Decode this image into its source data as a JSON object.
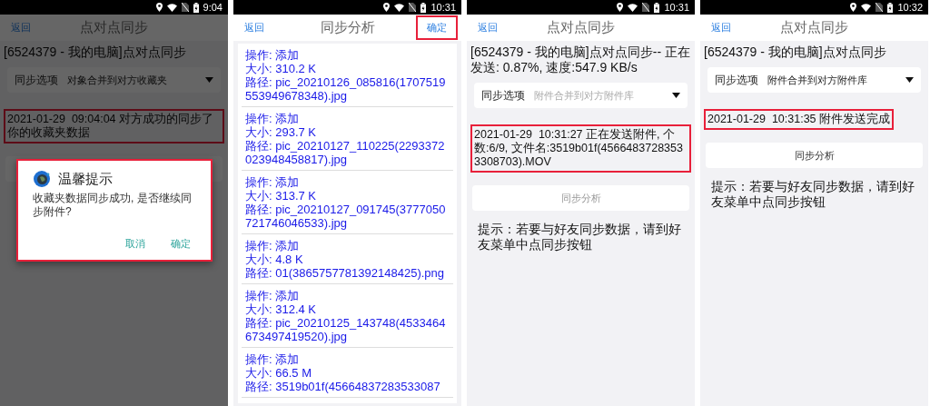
{
  "screens": [
    {
      "kind": "sync",
      "time": "9:04",
      "back": "返回",
      "title": "点对点同步",
      "device_line": "[6524379 - 我的电脑]点对点同步",
      "option": {
        "label": "同步选项",
        "value": "对象合并到对方收藏夹",
        "disabled": false
      },
      "message": {
        "text": "2021-01-29  09:04:04 对方成功的同步了你的收藏夹数据",
        "highlighted": true
      },
      "dimmed": true,
      "dialog": {
        "title": "温馨提示",
        "message": "收藏夹数据同步成功, 是否继续同步附件?",
        "buttons": [
          "取消",
          "确定"
        ],
        "highlighted": true
      }
    },
    {
      "kind": "analysis",
      "time": "10:31",
      "back": "返回",
      "title": "同步分析",
      "action": {
        "label": "确定",
        "highlighted": true
      },
      "items": [
        {
          "operation": "操作: 添加",
          "size": "大小: 310.2 K",
          "path": "路径: pic_20210126_085816(1707519553949678348).jpg"
        },
        {
          "operation": "操作: 添加",
          "size": "大小: 293.7 K",
          "path": "路径: pic_20210127_110225(2293372023948458817).jpg"
        },
        {
          "operation": "操作: 添加",
          "size": "大小: 313.7 K",
          "path": "路径: pic_20210127_091745(3777050721746046533).jpg"
        },
        {
          "operation": "操作: 添加",
          "size": "大小: 4.8 K",
          "path": "路径: 01(3865757781392148425).png"
        },
        {
          "operation": "操作: 添加",
          "size": "大小: 312.4 K",
          "path": "路径: pic_20210125_143748(4533464673497419520).jpg"
        },
        {
          "operation": "操作: 添加",
          "size": "大小: 66.5 M",
          "path": "路径: 3519b01f(45664837283533087"
        }
      ]
    },
    {
      "kind": "sync",
      "time": "10:31",
      "back": "返回",
      "title": "点对点同步",
      "device_line": "[6524379 - 我的电脑]点对点同步-- 正在发送: 0.87%, 速度:547.9 KB/s",
      "option": {
        "label": "同步选项",
        "value": "附件合并到对方附件库",
        "disabled": true
      },
      "message": {
        "text": "2021-01-29  10:31:27 正在发送附件, 个数:6/9, 文件名:3519b01f(45664837283533308703).MOV",
        "highlighted": true
      },
      "analysis_button": {
        "label": "同步分析",
        "disabled": true
      },
      "hint": "提示：若要与好友同步数据，请到好友菜单中点同步按钮",
      "dimmed": false
    },
    {
      "kind": "sync",
      "time": "10:32",
      "back": "返回",
      "title": "点对点同步",
      "device_line": "[6524379 - 我的电脑]点对点同步",
      "option": {
        "label": "同步选项",
        "value": "附件合并到对方附件库",
        "disabled": false
      },
      "message": {
        "text": "2021-01-29  10:31:35 附件发送完成",
        "highlighted": true
      },
      "analysis_button": {
        "label": "同步分析",
        "disabled": false
      },
      "hint": "提示：若要与好友同步数据，请到好友菜单中点同步按钮",
      "dimmed": false
    }
  ]
}
